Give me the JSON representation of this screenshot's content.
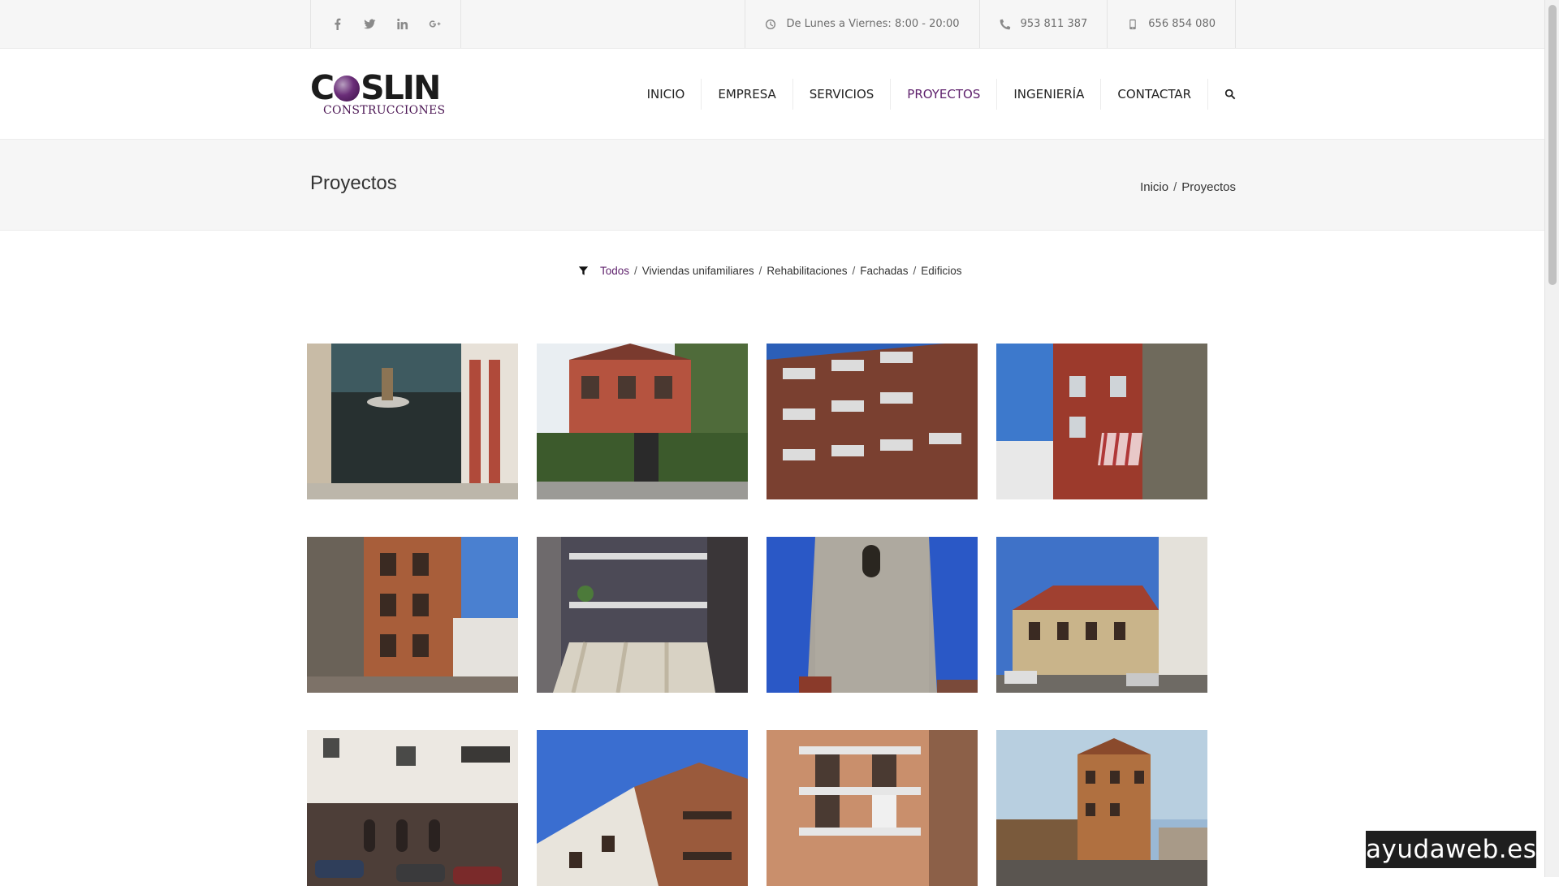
{
  "topbar": {
    "social_icons": [
      "facebook-icon",
      "twitter-icon",
      "linkedin-icon",
      "google-plus-icon"
    ],
    "hours": "De Lunes a Viernes: 8:00 - 20:00",
    "phone": "953 811 387",
    "mobile": "656 854 080"
  },
  "logo": {
    "word_a": "C",
    "word_b": "SLIN",
    "subtitle": "CONSTRUCCIONES",
    "accent": "#5d1f6b"
  },
  "nav": {
    "items": [
      {
        "label": "INICIO"
      },
      {
        "label": "EMPRESA"
      },
      {
        "label": "SERVICIOS"
      },
      {
        "label": "PROYECTOS",
        "active": true
      },
      {
        "label": "INGENIERÍA"
      },
      {
        "label": "CONTACTAR"
      }
    ],
    "search_icon": "search-icon"
  },
  "page": {
    "title": "Proyectos",
    "breadcrumb": [
      "Inicio",
      "Proyectos"
    ]
  },
  "filter": {
    "icon": "filter-icon",
    "items": [
      "Todos",
      "Viviendas unifamiliares",
      "Rehabilitaciones",
      "Fachadas",
      "Edificios"
    ],
    "active": "Todos"
  },
  "gallery": {
    "count": 12
  },
  "watermark": "ayudaweb.es",
  "colors": {
    "accent": "#5d1f6b",
    "topbar_bg": "#f6f6f6",
    "text": "#333333"
  }
}
